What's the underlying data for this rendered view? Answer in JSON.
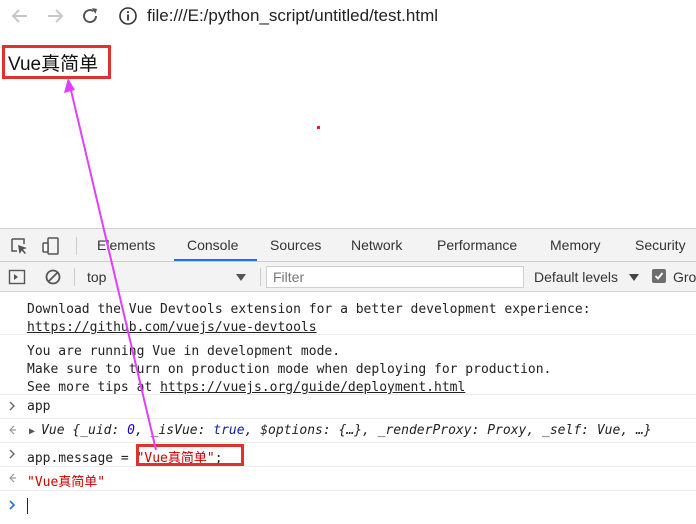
{
  "browser": {
    "url": "file:///E:/python_script/untitled/test.html",
    "icons": {
      "back": "arrow-left-icon",
      "forward": "arrow-right-icon",
      "reload": "reload-icon",
      "info": "info-circle-icon"
    }
  },
  "page": {
    "heading": "Vue真简单"
  },
  "devtools": {
    "tabs": [
      "Elements",
      "Console",
      "Sources",
      "Network",
      "Performance",
      "Memory",
      "Security"
    ],
    "active_tab": "Console",
    "toolbar": {
      "context": "top",
      "filter_placeholder": "Filter",
      "levels": "Default levels",
      "group_label": "Gro"
    },
    "console": {
      "msg1_line1": "Download the Vue Devtools extension for a better development experience:",
      "msg1_link": "https://github.com/vuejs/vue-devtools",
      "msg2_line1": "You are running Vue in development mode.",
      "msg2_line2": "Make sure to turn on production mode when deploying for production.",
      "msg2_line3_prefix": "See more tips at ",
      "msg2_link": "https://vuejs.org/guide/deployment.html",
      "input1": "app",
      "output1_prefix": "Vue {",
      "output1_k1": "_uid",
      "output1_v1": "0",
      "output1_k2": "_isVue",
      "output1_v2": "true",
      "output1_k3": "$options",
      "output1_v3": "{…}",
      "output1_k4": "_renderProxy",
      "output1_v4": "Proxy",
      "output1_k5": "_self",
      "output1_v5": "Vue",
      "output1_tail": "…}",
      "input2_prefix": "app.message = ",
      "input2_string": "\"Vue真简单\"",
      "input2_suffix": ";",
      "output2": "\"Vue真简单\""
    }
  },
  "colors": {
    "highlight_box": "#e0312f",
    "annotation_arrow": "#e040fb",
    "active_tab_underline": "#1a73e8",
    "string": "#c80000"
  }
}
